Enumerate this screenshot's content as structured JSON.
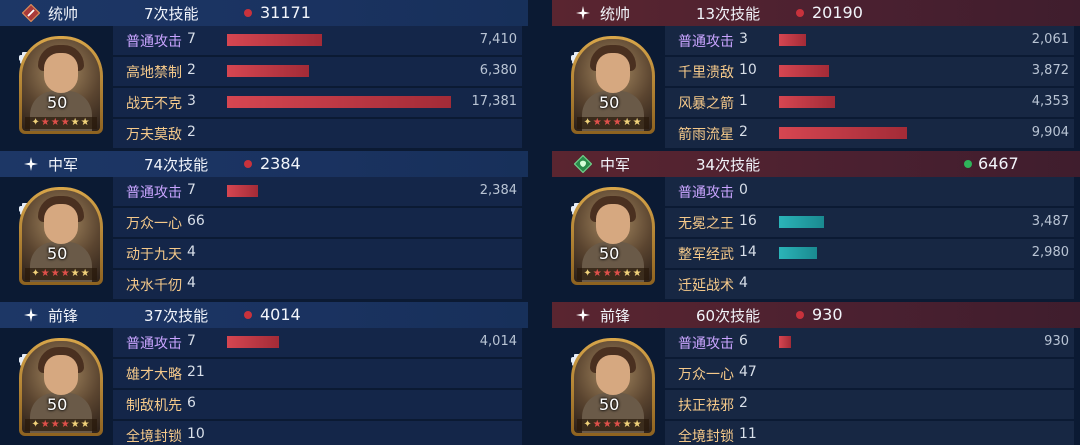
{
  "left": {
    "sections": [
      {
        "role": "统帅",
        "role_icon": "red-diamond-badge-icon",
        "skill_count": "7次技能",
        "total": "31171",
        "level": "50",
        "rows": [
          {
            "name": "普通攻击",
            "count": "7",
            "damage": "7,410",
            "value": 7410,
            "normal": true
          },
          {
            "name": "高地禁制",
            "count": "2",
            "damage": "6,380",
            "value": 6380
          },
          {
            "name": "战无不克",
            "count": "3",
            "damage": "17,381",
            "value": 17381
          },
          {
            "name": "万夫莫敌",
            "count": "2",
            "damage": "",
            "value": 0
          }
        ]
      },
      {
        "role": "中军",
        "role_icon": "sparkle-icon",
        "skill_count": "74次技能",
        "total": "2384",
        "level": "50",
        "rows": [
          {
            "name": "普通攻击",
            "count": "7",
            "damage": "2,384",
            "value": 2384,
            "normal": true
          },
          {
            "name": "万众一心",
            "count": "66",
            "damage": "",
            "value": 0
          },
          {
            "name": "动于九天",
            "count": "4",
            "damage": "",
            "value": 0
          },
          {
            "name": "决水千仞",
            "count": "4",
            "damage": "",
            "value": 0
          }
        ]
      },
      {
        "role": "前锋",
        "role_icon": "sparkle-icon",
        "skill_count": "37次技能",
        "total": "4014",
        "level": "50",
        "rows": [
          {
            "name": "普通攻击",
            "count": "7",
            "damage": "4,014",
            "value": 4014,
            "normal": true
          },
          {
            "name": "雄才大略",
            "count": "21",
            "damage": "",
            "value": 0
          },
          {
            "name": "制敌机先",
            "count": "6",
            "damage": "",
            "value": 0
          },
          {
            "name": "全境封锁",
            "count": "10",
            "damage": "",
            "value": 0
          }
        ]
      }
    ]
  },
  "right": {
    "sections": [
      {
        "role": "统帅",
        "role_icon": "sparkle-icon",
        "skill_count": "13次技能",
        "total": "20190",
        "level": "50",
        "rows": [
          {
            "name": "普通攻击",
            "count": "3",
            "damage": "2,061",
            "value": 2061,
            "normal": true
          },
          {
            "name": "千里溃敌",
            "count": "10",
            "damage": "3,872",
            "value": 3872
          },
          {
            "name": "风暴之箭",
            "count": "1",
            "damage": "4,353",
            "value": 4353
          },
          {
            "name": "箭雨流星",
            "count": "2",
            "damage": "9,904",
            "value": 9904
          }
        ]
      },
      {
        "role": "中军",
        "role_icon": "green-diamond-badge-icon",
        "skill_count": "34次技能",
        "total": "6467",
        "dot_color": "green",
        "level": "50",
        "rows": [
          {
            "name": "普通攻击",
            "count": "0",
            "damage": "",
            "value": 0,
            "normal": true
          },
          {
            "name": "无冕之王",
            "count": "16",
            "damage": "3,487",
            "value": 3487,
            "teal": true
          },
          {
            "name": "整军经武",
            "count": "14",
            "damage": "2,980",
            "value": 2980,
            "teal": true
          },
          {
            "name": "迁延战术",
            "count": "4",
            "damage": "",
            "value": 0
          }
        ]
      },
      {
        "role": "前锋",
        "role_icon": "sparkle-icon",
        "skill_count": "60次技能",
        "total": "930",
        "level": "50",
        "rows": [
          {
            "name": "普通攻击",
            "count": "6",
            "damage": "930",
            "value": 930,
            "normal": true
          },
          {
            "name": "万众一心",
            "count": "47",
            "damage": "",
            "value": 0
          },
          {
            "name": "扶正祛邪",
            "count": "2",
            "damage": "",
            "value": 0
          },
          {
            "name": "全境封锁",
            "count": "11",
            "damage": "",
            "value": 0
          }
        ]
      }
    ]
  },
  "colors": {
    "bar_red": "#d64651",
    "bar_teal": "#2bb4b8",
    "dot_red": "#c8323c",
    "dot_green": "#2fb45a",
    "skill_gold": "#f5c98a",
    "skill_purple": "#c9a4ff"
  }
}
